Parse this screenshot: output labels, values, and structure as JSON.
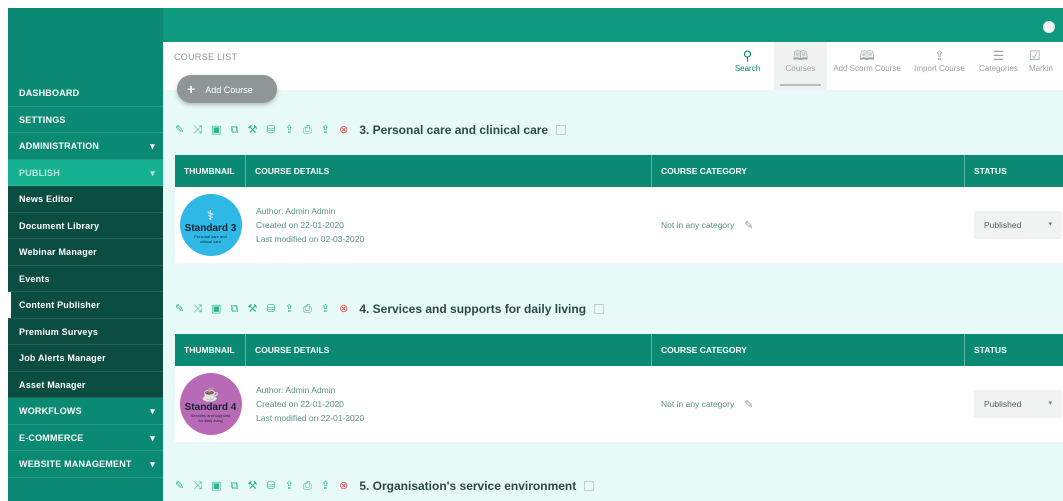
{
  "sidebar": {
    "items": [
      {
        "label": "DASHBOARD",
        "kind": "top",
        "caret": false
      },
      {
        "label": "SETTINGS",
        "kind": "top",
        "caret": false
      },
      {
        "label": "ADMINISTRATION",
        "kind": "top",
        "caret": true
      },
      {
        "label": "PUBLISH",
        "kind": "active",
        "caret": true
      },
      {
        "label": "News Editor",
        "kind": "sub"
      },
      {
        "label": "Document Library",
        "kind": "sub"
      },
      {
        "label": "Webinar Manager",
        "kind": "sub"
      },
      {
        "label": "Events",
        "kind": "sub"
      },
      {
        "label": "Content Publisher",
        "kind": "sub-selected"
      },
      {
        "label": "Premium Surveys",
        "kind": "sub"
      },
      {
        "label": "Job Alerts Manager",
        "kind": "sub"
      },
      {
        "label": "Asset Manager",
        "kind": "sub"
      },
      {
        "label": "WORKFLOWS",
        "kind": "top",
        "caret": true
      },
      {
        "label": "E-COMMERCE",
        "kind": "top",
        "caret": true
      },
      {
        "label": "WEBSITE MANAGEMENT",
        "kind": "top",
        "caret": true
      }
    ],
    "caret_glyph": "▾"
  },
  "header": {
    "breadcrumb": "COURSE LIST",
    "add_button": {
      "icon": "+",
      "label": "Add Course"
    },
    "tools": [
      {
        "label": "Search",
        "icon": "search-icon",
        "glyph": "⚲"
      },
      {
        "label": "Courses",
        "icon": "book-icon",
        "glyph": "🕮"
      },
      {
        "label": "Add Scorm Course",
        "icon": "book-plus-icon",
        "glyph": "🕮"
      },
      {
        "label": "Import Course",
        "icon": "upload-icon",
        "glyph": "⇪"
      },
      {
        "label": "Categories",
        "icon": "list-icon",
        "glyph": "☰"
      },
      {
        "label": "Markin",
        "icon": "check-square-icon",
        "glyph": "☑"
      }
    ]
  },
  "table_headers": {
    "thumbnail": "THUMBNAIL",
    "details": "COURSE DETAILS",
    "category": "COURSE CATEGORY",
    "status": "STATUS"
  },
  "action_icons": "✎ ⤨ ▣ ⧉ ⚒ ⛁ ⇪ ⎙ ⇪",
  "cancel_icon": "⊗",
  "courses": [
    {
      "title": "3. Personal care and clinical care",
      "author": "Author: Admin Admin",
      "created": "Created on 22-01-2020",
      "modified": "Last modified on 02-03-2020",
      "category": "Not in any category",
      "status": "Published",
      "badge": {
        "label": "Standard 3",
        "sub": "Personal care and clinical care",
        "color": "#2fb7e6",
        "glyph": "⚕"
      }
    },
    {
      "title": "4. Services and supports for daily living",
      "author": "Author: Admin Admin",
      "created": "Created on 22-01-2020",
      "modified": "Last modified on 22-01-2020",
      "category": "Not in any category",
      "status": "Published",
      "badge": {
        "label": "Standard 4",
        "sub": "Services and supports for daily living",
        "color": "#b96ab6",
        "glyph": "☕"
      }
    },
    {
      "title": "5. Organisation's service environment"
    }
  ],
  "icons": {
    "pencil": "✎",
    "dropdown": "▾"
  },
  "colors": {
    "primary": "#0a8a72",
    "sidebar_dark": "#0b4d40",
    "background": "#e8faf8"
  }
}
